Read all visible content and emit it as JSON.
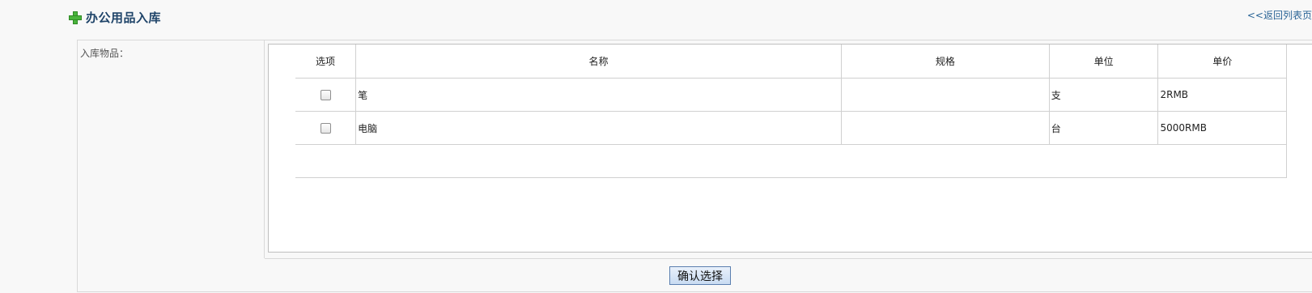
{
  "header": {
    "title": "办公用品入库",
    "back_link": "<<返回列表页"
  },
  "form": {
    "label": "入库物品：",
    "columns": [
      "选项",
      "名称",
      "规格",
      "单位",
      "单价"
    ],
    "rows": [
      {
        "name": "笔",
        "spec": "",
        "unit": "支",
        "price": "2RMB"
      },
      {
        "name": "电脑",
        "spec": "",
        "unit": "台",
        "price": "5000RMB"
      }
    ],
    "confirm_label": "确认选择"
  },
  "colors": {
    "title": "#1f4469",
    "link": "#2a6496",
    "plus_icon": "#49b43c"
  }
}
